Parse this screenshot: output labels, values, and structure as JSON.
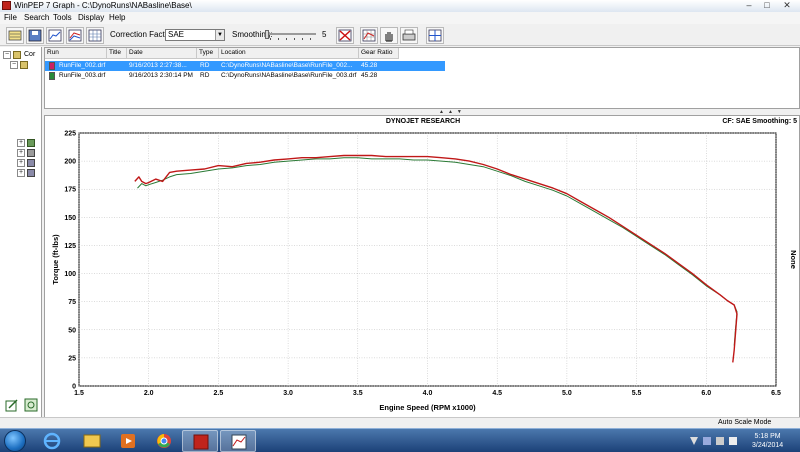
{
  "window": {
    "title": "WinPEP 7 - Graph - C:\\DynoRuns\\NABasline\\Base\\",
    "title_short": "WinPEP 7   Graph - C:\\DynoRuns\\NABasline\\Base\\"
  },
  "menu": [
    "File",
    "Search",
    "Tools",
    "Display",
    "Help"
  ],
  "toolbar": {
    "correction_factor_label": "Correction Factor:",
    "correction_factor_value": "SAE",
    "smoothing_label": "Smoothing:",
    "smoothing_value": "5"
  },
  "tree": {
    "root_label": "Cor"
  },
  "run_table": {
    "columns": [
      "Run",
      "Title",
      "Date",
      "Type",
      "Location",
      "Gear Ratio"
    ],
    "rows": [
      {
        "run": "RunFile_002.drf",
        "title": "",
        "date": "9/16/2013 2:27:38...",
        "type": "RD",
        "location": "C:\\DynoRuns\\NABasline\\Base\\RunFile_002...",
        "gear_ratio": "45.28",
        "color": "#cc2266",
        "selected": true
      },
      {
        "run": "RunFile_003.drf",
        "title": "",
        "date": "9/16/2013 2:30:14 PM",
        "type": "RD",
        "location": "C:\\DynoRuns\\NABasline\\Base\\RunFile_003.drf",
        "gear_ratio": "45.28",
        "color": "#2a8a3a",
        "selected": false
      }
    ]
  },
  "graph": {
    "header_center": "DYNOJET RESEARCH",
    "header_right": "CF: SAE  Smoothing: 5",
    "right_label": "None"
  },
  "chart_data": {
    "type": "line",
    "title": "DYNOJET RESEARCH",
    "xlabel": "Engine Speed (RPM x1000)",
    "ylabel": "Torque (ft-lbs)",
    "xlim": [
      1.5,
      6.5
    ],
    "ylim": [
      0,
      225
    ],
    "xticks": [
      "1.5",
      "2.0",
      "2.5",
      "3.0",
      "3.5",
      "4.0",
      "4.5",
      "5.0",
      "5.5",
      "6.0",
      "6.5"
    ],
    "yticks": [
      "0",
      "25",
      "50",
      "75",
      "100",
      "125",
      "150",
      "175",
      "200",
      "225"
    ],
    "grid": true,
    "series": [
      {
        "color": "#c01818",
        "x": [
          1.9,
          1.93,
          1.95,
          1.98,
          2.0,
          2.05,
          2.1,
          2.15,
          2.2,
          2.3,
          2.4,
          2.5,
          2.6,
          2.7,
          2.8,
          2.9,
          3.0,
          3.1,
          3.2,
          3.3,
          3.4,
          3.5,
          3.6,
          3.7,
          3.8,
          3.9,
          4.0,
          4.1,
          4.2,
          4.3,
          4.4,
          4.5,
          4.6,
          4.7,
          4.8,
          4.9,
          5.0,
          5.1,
          5.2,
          5.3,
          5.4,
          5.5,
          5.6,
          5.7,
          5.8,
          5.9,
          6.0,
          6.1,
          6.15,
          6.2,
          6.22,
          6.21,
          6.2,
          6.19
        ],
        "y": [
          182,
          186,
          182,
          180,
          181,
          184,
          182,
          190,
          191,
          192,
          193,
          196,
          195,
          198,
          199,
          201,
          202,
          203,
          203,
          204,
          205,
          205,
          205,
          204,
          204,
          204,
          204,
          203,
          202,
          200,
          197,
          193,
          188,
          184,
          180,
          176,
          171,
          164,
          157,
          150,
          142,
          134,
          126,
          118,
          109,
          100,
          90,
          81,
          76,
          72,
          64,
          48,
          32,
          21
        ]
      },
      {
        "color": "#2a7a35",
        "x": [
          1.92,
          1.95,
          1.98,
          2.0,
          2.05,
          2.1,
          2.15,
          2.2,
          2.3,
          2.4,
          2.5,
          2.6,
          2.7,
          2.8,
          2.9,
          3.0,
          3.1,
          3.2,
          3.3,
          3.4,
          3.5,
          3.6,
          3.7,
          3.8,
          3.9,
          4.0,
          4.1,
          4.2,
          4.3,
          4.4,
          4.5,
          4.6,
          4.7,
          4.8,
          4.9,
          5.0,
          5.1,
          5.2,
          5.3,
          5.4,
          5.5,
          5.6,
          5.7,
          5.8,
          5.9,
          6.0,
          6.1,
          6.15,
          6.2,
          6.22,
          6.21,
          6.2
        ],
        "y": [
          176,
          180,
          178,
          179,
          181,
          183,
          186,
          188,
          189,
          191,
          193,
          194,
          196,
          197,
          199,
          200,
          201,
          202,
          202,
          203,
          203,
          202,
          202,
          202,
          201,
          201,
          200,
          199,
          197,
          195,
          191,
          187,
          182,
          178,
          174,
          169,
          162,
          155,
          148,
          141,
          133,
          125,
          117,
          108,
          99,
          89,
          81,
          76,
          72,
          66,
          52,
          36
        ]
      }
    ]
  },
  "status": {
    "mode": "Auto Scale Mode"
  },
  "clock": {
    "time": "5:18 PM",
    "date": "3/24/2014"
  },
  "colors": {
    "selection": "#3399ff",
    "taskbar": "#1c4178"
  },
  "icons": [
    "open-icon",
    "save-icon",
    "graph-icon",
    "lines-icon",
    "sheet-icon",
    "chart-icon",
    "zoom-icon",
    "hand-icon",
    "print-icon",
    "cursor-icon",
    "no-smooth-icon"
  ]
}
